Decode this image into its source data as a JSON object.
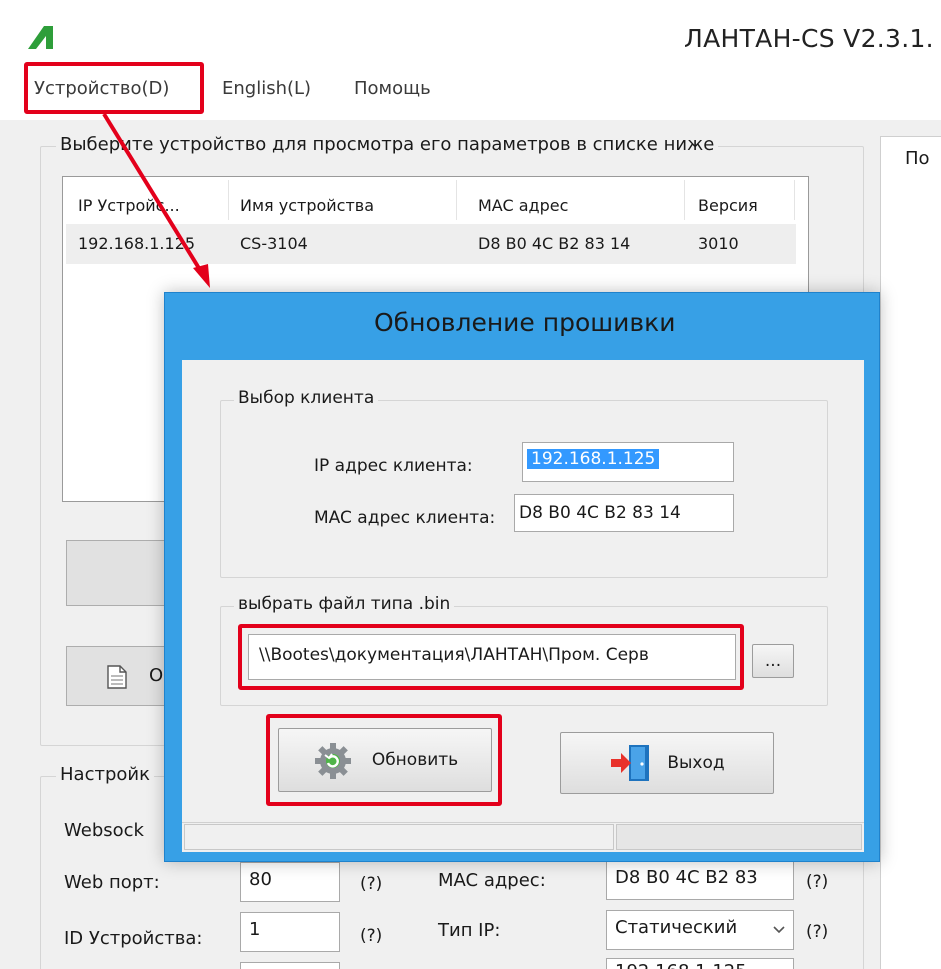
{
  "window": {
    "title": "ЛАНТАН-CS V2.3.1.",
    "menu": [
      "Устройство(D)",
      "English(L)",
      "Помощь"
    ]
  },
  "main": {
    "device_group_legend": "Выберите устройство для просмотра его параметров в списке ниже",
    "list_headers": [
      "IP Устройс...",
      "Имя устройства",
      "MAC адрес",
      "Версия"
    ],
    "list_rows": [
      {
        "ip": "192.168.1.125",
        "name": "CS-3104",
        "mac": "D8 B0 4C B2 83 14",
        "version": "3010"
      }
    ],
    "button_fragment": "О",
    "right_panel_label": "По",
    "settings_legend": "Настройк",
    "websocket_label": "Websock",
    "web_port_label": "Web порт:",
    "web_port_value": "80",
    "device_id_label": "ID Устройства:",
    "device_id_value": "1",
    "mac_label": "MAC адрес:",
    "mac_value": "D8 B0 4C B2 83",
    "ip_type_label": "Тип IP:",
    "ip_type_value": "Статический",
    "partial_value": "192.168.1.125",
    "help": "(?)"
  },
  "dialog": {
    "title": "Обновление прошивки",
    "client_group_legend": "Выбор клиента",
    "ip_label": "IP адрес клиента:",
    "ip_value": "192.168.1.125",
    "mac_label": "MAC адрес клиента:",
    "mac_value": "D8 B0 4C B2 83 14",
    "file_group_legend": "выбрать файл типа .bin",
    "file_path": "\\\\Bootes\\документация\\ЛАНТАН\\Пром. Серв",
    "browse_label": "...",
    "update_label": "Обновить",
    "exit_label": "Выход"
  },
  "colors": {
    "dialog_frame": "#37a0e6",
    "annotation": "#e3001b",
    "selection": "#3399ff",
    "logo": "#2e9e3a"
  }
}
